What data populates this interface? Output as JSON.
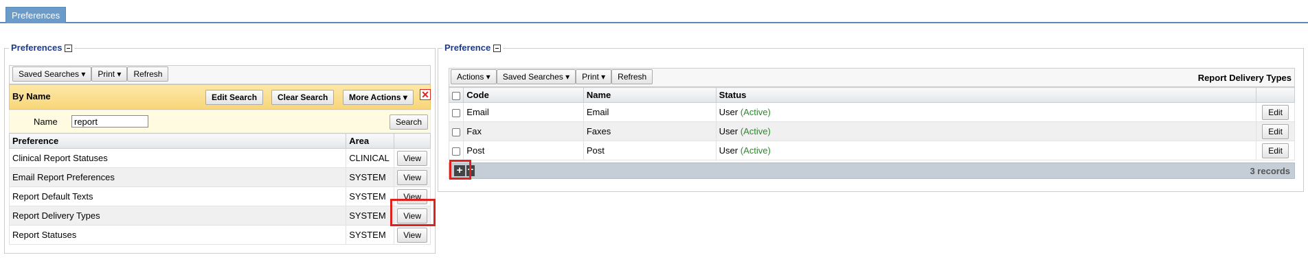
{
  "tab": {
    "label": "Preferences"
  },
  "left_panel": {
    "title": "Preferences",
    "toolbar": {
      "saved_searches": "Saved Searches ▾",
      "print": "Print ▾",
      "refresh": "Refresh"
    },
    "search": {
      "title": "By Name",
      "edit": "Edit Search",
      "clear": "Clear Search",
      "more": "More Actions ▾",
      "name_label": "Name",
      "name_value": "report",
      "search_button": "Search"
    },
    "columns": [
      "Preference",
      "Area",
      ""
    ],
    "rows": [
      {
        "preference": "Clinical Report Statuses",
        "area": "CLINICAL",
        "action": "View"
      },
      {
        "preference": "Email Report Preferences",
        "area": "SYSTEM",
        "action": "View"
      },
      {
        "preference": "Report Default Texts",
        "area": "SYSTEM",
        "action": "View"
      },
      {
        "preference": "Report Delivery Types",
        "area": "SYSTEM",
        "action": "View"
      },
      {
        "preference": "Report Statuses",
        "area": "SYSTEM",
        "action": "View"
      }
    ]
  },
  "right_panel": {
    "title": "Preference",
    "toolbar": {
      "actions": "Actions ▾",
      "saved_searches": "Saved Searches ▾",
      "print": "Print ▾",
      "refresh": "Refresh"
    },
    "heading": "Report Delivery Types",
    "columns": [
      "Code",
      "Name",
      "Status",
      ""
    ],
    "rows": [
      {
        "code": "Email",
        "name": "Email",
        "status": "User",
        "state": "(Active)",
        "action": "Edit"
      },
      {
        "code": "Fax",
        "name": "Faxes",
        "status": "User",
        "state": "(Active)",
        "action": "Edit"
      },
      {
        "code": "Post",
        "name": "Post",
        "status": "User",
        "state": "(Active)",
        "action": "Edit"
      }
    ],
    "records": "3 records"
  }
}
